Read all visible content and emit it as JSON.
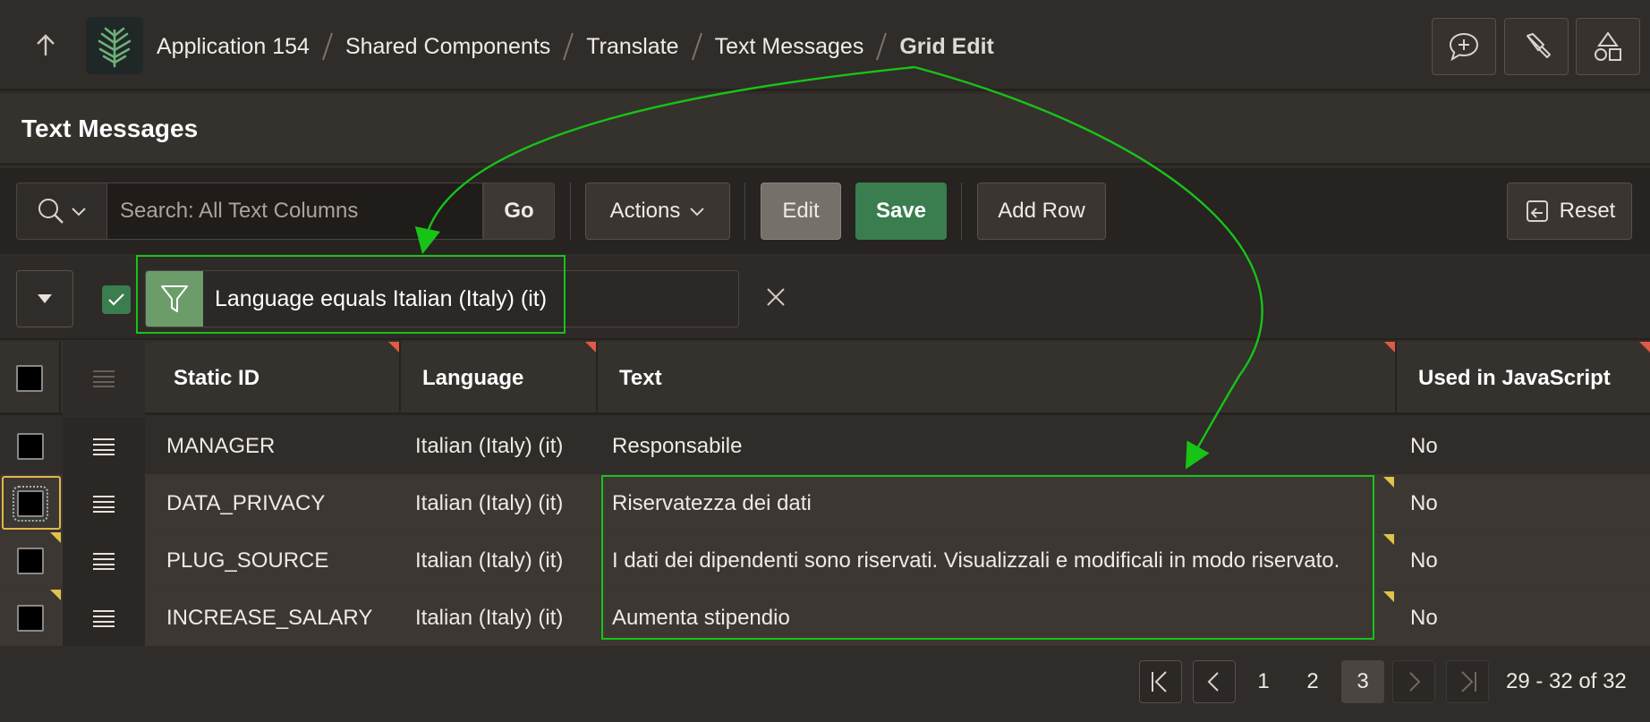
{
  "header": {
    "breadcrumbs": [
      "Application 154",
      "Shared Components",
      "Translate",
      "Text Messages",
      "Grid Edit"
    ],
    "buttons": [
      "add-comment-icon",
      "developer-tools-icon",
      "shapes-icon"
    ]
  },
  "region": {
    "title": "Text Messages"
  },
  "toolbar": {
    "search_placeholder": "Search: All Text Columns",
    "go_label": "Go",
    "actions_label": "Actions",
    "edit_label": "Edit",
    "save_label": "Save",
    "add_row_label": "Add Row",
    "reset_label": "Reset"
  },
  "filter": {
    "text": "Language equals Italian (Italy) (it)",
    "enabled": true
  },
  "grid": {
    "columns": [
      "Static ID",
      "Language",
      "Text",
      "Used in JavaScript"
    ],
    "rows": [
      {
        "static_id": "MANAGER",
        "language": "Italian (Italy) (it)",
        "text": "Responsabile",
        "used_in_js": "No"
      },
      {
        "static_id": "DATA_PRIVACY",
        "language": "Italian (Italy) (it)",
        "text": "Riservatezza dei dati",
        "used_in_js": "No"
      },
      {
        "static_id": "PLUG_SOURCE",
        "language": "Italian (Italy) (it)",
        "text": "I dati dei dipendenti sono riservati. Visualizzali e modificali in modo riservato.",
        "used_in_js": "No"
      },
      {
        "static_id": "INCREASE_SALARY",
        "language": "Italian (Italy) (it)",
        "text": "Aumenta stipendio",
        "used_in_js": "No"
      }
    ]
  },
  "pagination": {
    "pages": [
      "1",
      "2",
      "3"
    ],
    "current_page": "3",
    "range_text": "29 - 32 of 32"
  },
  "colors": {
    "annotation": "#17c317",
    "save_button": "#3a7d4f",
    "filter_icon_bg": "#6d9c6b",
    "changed_marker": "#e0c44a",
    "required_marker": "#e05a45"
  }
}
